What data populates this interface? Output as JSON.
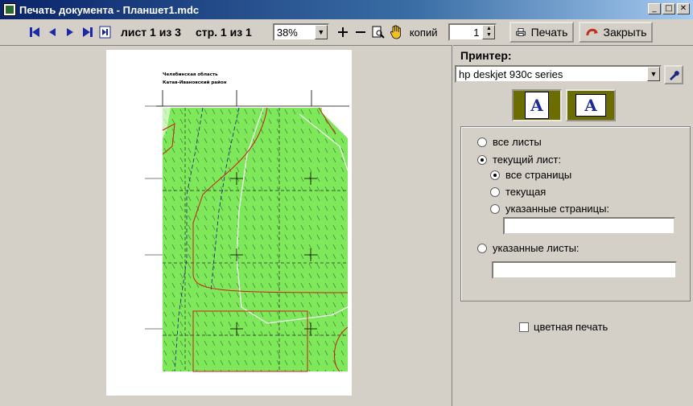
{
  "window": {
    "title": "Печать документа - Планшет1.mdc",
    "controls": [
      "minimize",
      "maximize",
      "close"
    ]
  },
  "toolbar": {
    "sheet_info": "лист 1 из 3",
    "page_info": "стр. 1 из 1",
    "zoom": "38%",
    "copies_label": "копий",
    "copies": "1",
    "print_label": "Печать",
    "close_label": "Закрыть",
    "icons": [
      "first-page-icon",
      "prev-page-icon",
      "next-page-icon",
      "last-page-icon",
      "last-sheet-icon",
      "zoom-in-icon",
      "zoom-out-icon",
      "page-zoom-icon",
      "hand-icon",
      "printer-icon",
      "close-arrow-icon"
    ]
  },
  "preview": {
    "header_line1": "Челябинская область",
    "header_line2": "Катав-Ивановский район",
    "map_color": "#7ee85a"
  },
  "side": {
    "printer_label": "Принтер:",
    "printer": "hp deskjet 930c series",
    "orientation_letter": "A",
    "options": {
      "all_sheets": "все листы",
      "current_sheet": "текущий лист:",
      "all_pages": "все страницы",
      "current_page": "текущая",
      "specified_pages": "указанные страницы:",
      "specified_sheets": "указанные листы:"
    },
    "color_print": "цветная печать"
  }
}
